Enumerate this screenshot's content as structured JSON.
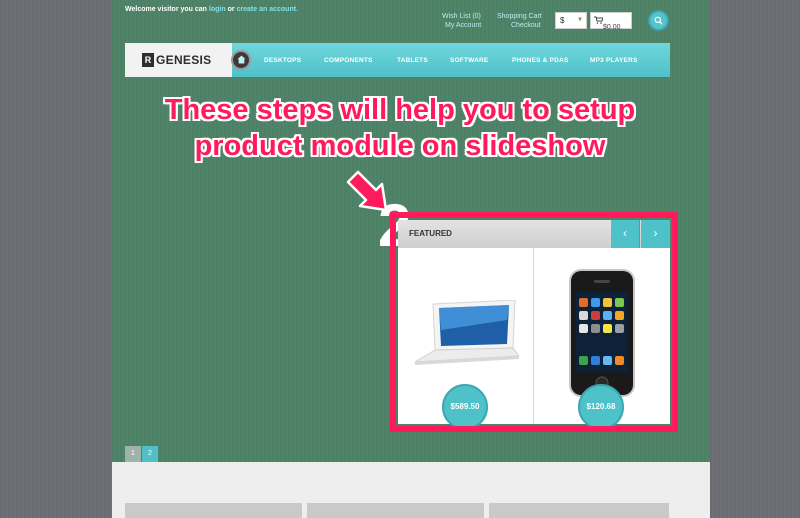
{
  "header": {
    "welcome_prefix": "Welcome visitor you can",
    "login_link": "login",
    "welcome_or": "or",
    "create_account_link": "create an account.",
    "wishlist": "Wish List (0)",
    "my_account": "My Account",
    "shopping_cart": "Shopping Cart",
    "checkout": "Checkout",
    "currency_symbol": "$",
    "cart_total": "$0.00"
  },
  "navbar": {
    "logo_mark": "R",
    "logo_text": "GENESIS",
    "items": [
      "DESKTOPS",
      "COMPONENTS",
      "TABLETS",
      "SOFTWARE",
      "PHONES & PDAS",
      "MP3 PLAYERS"
    ]
  },
  "annotation": {
    "line1": "These steps will help you to setup",
    "line2": "product module on slideshow",
    "step_number": "2"
  },
  "module": {
    "title": "FEATURED",
    "prev_icon": "‹",
    "next_icon": "›",
    "products": [
      {
        "price": "$589.50",
        "image": "laptop-image"
      },
      {
        "price": "$120.68",
        "image": "phone-image"
      }
    ]
  },
  "pager": {
    "pages": [
      "1",
      "2"
    ],
    "active": "2"
  },
  "icons": {
    "search": "search-icon",
    "home": "home-icon",
    "cart": "cart-icon"
  },
  "colors": {
    "accent": "#4fc1c9",
    "background": "#4e8265",
    "highlight": "#ff1a5b"
  }
}
